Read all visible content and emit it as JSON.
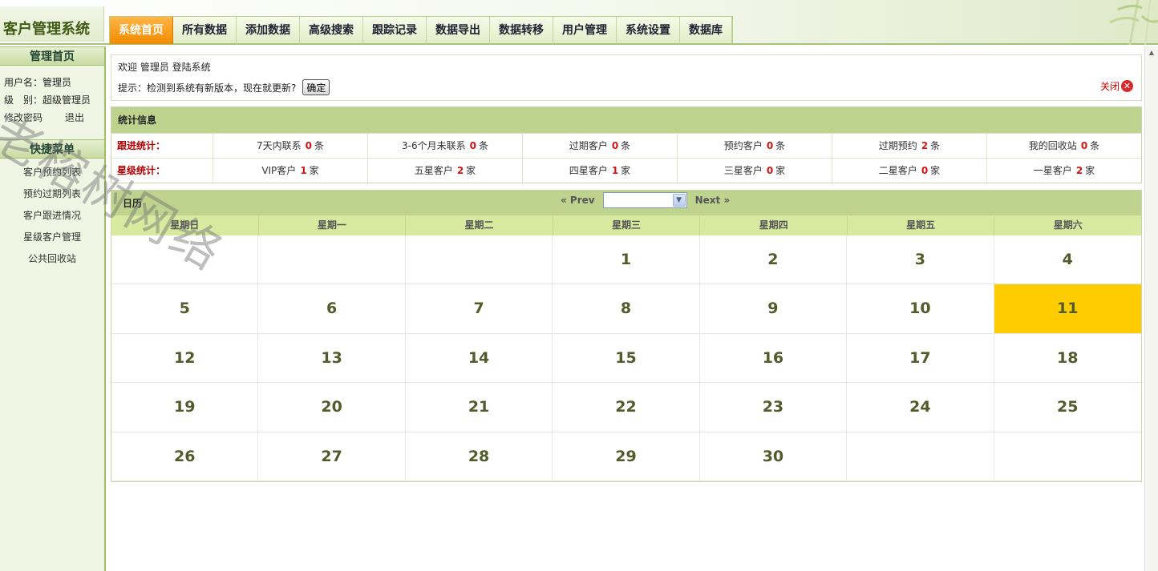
{
  "app": {
    "title": "客户管理系统"
  },
  "nav": {
    "items": [
      {
        "label": "系统首页",
        "active": true
      },
      {
        "label": "所有数据"
      },
      {
        "label": "添加数据"
      },
      {
        "label": "高级搜索"
      },
      {
        "label": "跟踪记录"
      },
      {
        "label": "数据导出"
      },
      {
        "label": "数据转移"
      },
      {
        "label": "用户管理"
      },
      {
        "label": "系统设置"
      },
      {
        "label": "数据库"
      }
    ]
  },
  "sidebar": {
    "title": "管理首页",
    "user": {
      "name_label": "用户名：管理员",
      "level_label": "级　别：超级管理员",
      "change_password": "修改密码",
      "logout": "退出"
    },
    "quick_title": "快捷菜单",
    "menu": [
      "客户预约列表",
      "预约过期列表",
      "客户跟进情况",
      "星级客户管理",
      "公共回收站"
    ]
  },
  "notice": {
    "welcome": "欢迎 管理员 登陆系统",
    "prompt": "提示：检测到系统有新版本，现在就更新?",
    "ok": "确定",
    "close": "关闭"
  },
  "stats": {
    "title": "统计信息",
    "rows": [
      {
        "label": "跟进统计：",
        "cells": [
          {
            "name": "7天内联系",
            "value": "0",
            "unit": "条"
          },
          {
            "name": "3-6个月未联系",
            "value": "0",
            "unit": "条"
          },
          {
            "name": "过期客户",
            "value": "0",
            "unit": "条"
          },
          {
            "name": "预约客户",
            "value": "0",
            "unit": "条"
          },
          {
            "name": "过期预约",
            "value": "2",
            "unit": "条"
          },
          {
            "name": "我的回收站",
            "value": "0",
            "unit": "条"
          }
        ]
      },
      {
        "label": "星级统计：",
        "cells": [
          {
            "name": "VIP客户",
            "value": "1",
            "unit": "家"
          },
          {
            "name": "五星客户",
            "value": "2",
            "unit": "家"
          },
          {
            "name": "四星客户",
            "value": "1",
            "unit": "家"
          },
          {
            "name": "三星客户",
            "value": "0",
            "unit": "家"
          },
          {
            "name": "二星客户",
            "value": "0",
            "unit": "家"
          },
          {
            "name": "一星客户",
            "value": "2",
            "unit": "家"
          }
        ]
      }
    ]
  },
  "calendar": {
    "title": "日历",
    "prev": "« Prev",
    "next": "Next »",
    "selected_month": "",
    "weekdays": [
      "星期日",
      "星期一",
      "星期二",
      "星期三",
      "星期四",
      "星期五",
      "星期六"
    ],
    "days": [
      "",
      "",
      "",
      "1",
      "2",
      "3",
      "4",
      "5",
      "6",
      "7",
      "8",
      "9",
      "10",
      "11",
      "12",
      "13",
      "14",
      "15",
      "16",
      "17",
      "18",
      "19",
      "20",
      "21",
      "22",
      "23",
      "24",
      "25",
      "26",
      "27",
      "28",
      "29",
      "30",
      "",
      ""
    ],
    "today": "11",
    "today_color": "#ffcc00"
  },
  "watermark": "老榕树网络"
}
